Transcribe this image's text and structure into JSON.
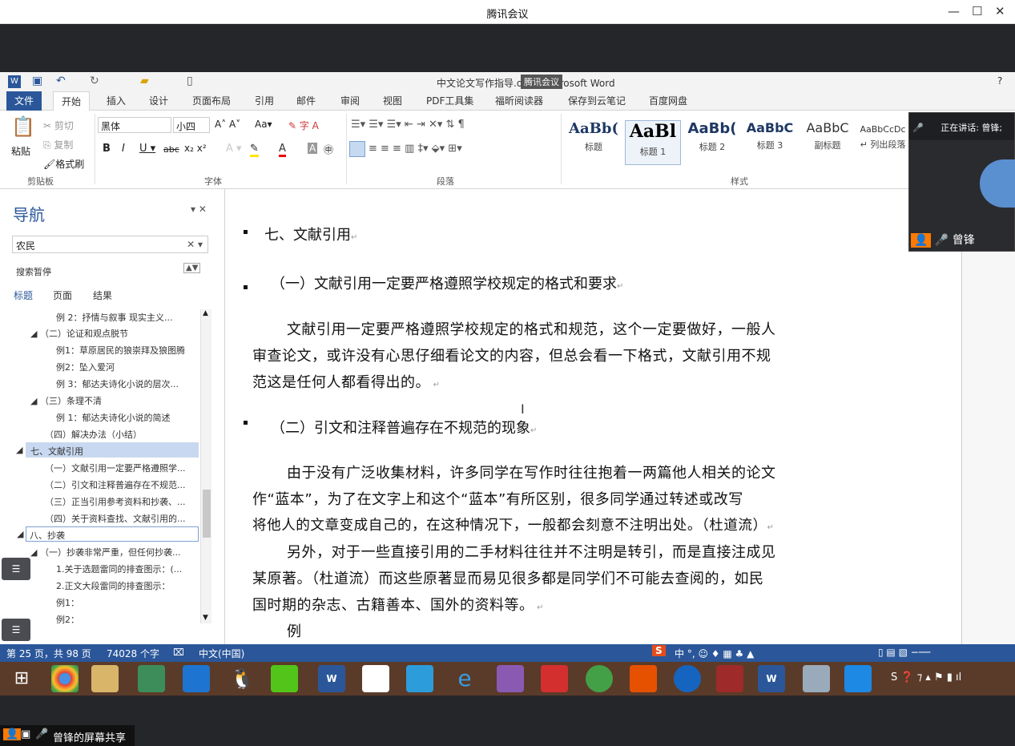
{
  "meeting": {
    "title": "腾讯会议",
    "share_label": "曾锋的屏幕共享",
    "speaking": "正在讲话: 曾锋;",
    "participant": "曾锋"
  },
  "word": {
    "title": "中文论文写作指导.doc - Microsoft Word",
    "overlay": "腾讯会议",
    "help": "?",
    "tabs": [
      "文件",
      "开始",
      "插入",
      "设计",
      "页面布局",
      "引用",
      "邮件",
      "审阅",
      "视图",
      "PDF工具集",
      "福昕阅读器",
      "保存到云笔记",
      "百度网盘"
    ],
    "clipboard": {
      "cut": "剪切",
      "copy": "复制",
      "paste": "粘贴",
      "format": "格式刷",
      "label": "剪贴板"
    },
    "font": {
      "name": "黑体",
      "size": "小四",
      "label": "字体"
    },
    "paragraph_label": "段落",
    "styles": {
      "label": "样式",
      "items": [
        {
          "preview": "AaBb(",
          "name": "标题"
        },
        {
          "preview": "AaBl",
          "name": "标题 1"
        },
        {
          "preview": "AaBb(",
          "name": "标题 2"
        },
        {
          "preview": "AaBbC",
          "name": "标题 3"
        },
        {
          "preview": "AaBbC",
          "name": "副标题"
        },
        {
          "preview": "AaBbCcDc",
          "name": "↵ 列出段落"
        }
      ]
    }
  },
  "nav": {
    "title": "导航",
    "search_value": "农民",
    "search_status": "搜索暂停",
    "tabs": [
      "标题",
      "页面",
      "结果"
    ],
    "items": [
      "例 2：抒情与叙事  现实主义...",
      "（二）论证和观点脱节",
      "例1：草原居民的狼崇拜及狼图腾",
      "例2：坠入爱河",
      "例 3：郁达夫诗化小说的层次...",
      "（三）条理不清",
      "例 1：郁达夫诗化小说的简述",
      "（四）解决办法（小结）",
      "七、文献引用",
      "（一）文献引用一定要严格遵照学...",
      "（二）引文和注释普遍存在不规范...",
      "（三）正当引用参考资料和抄袭、...",
      "（四）关于资料查找、文献引用的...",
      "八、抄袭",
      "（一）抄袭非常严重，但任何抄袭...",
      "1.关于选题雷同的排查图示：(...",
      "2.正文大段雷同的排查图示：",
      "例1：",
      "例2："
    ]
  },
  "doc": {
    "h1": "七、文献引用",
    "h2a": "（一）文献引用一定要严格遵照学校规定的格式和要求",
    "p1": [
      "文献引用一定要严格遵照学校规定的格式和规范，这个一定要做好，一般人",
      "审查论文，或许没有心思仔细看论文的内容，但总会看一下格式，文献引用不规",
      "范这是任何人都看得出的。"
    ],
    "h2b": "（二）引文和注释普遍存在不规范的现象",
    "p2": [
      "由于没有广泛收集材料，许多同学在写作时往往抱着一两篇他人相关的论文",
      "作“蓝本”，为了在文字上和这个“蓝本”有所区别，很多同学通过转述或改写",
      "将他人的文章变成自己的，在这种情况下，一般都会刻意不注明出处。（杜道流）"
    ],
    "p3": [
      "另外，对于一些直接引用的二手材料往往并不注明是转引，而是直接注成见",
      "某原著。（杜道流）而这些原著显而易见很多都是同学们不可能去查阅的，如民",
      "国时期的杂志、古籍善本、国外的资料等。"
    ],
    "p4": "例"
  },
  "status": {
    "page": "第 25 页，共 98 页",
    "words": "74028 个字",
    "lang": "中文(中国)",
    "ime": "中 °, ☺ ♦ ▦ ♣ ▲"
  },
  "colors": {
    "word_blue": "#2b579a",
    "meeting_dark": "#25262a"
  }
}
